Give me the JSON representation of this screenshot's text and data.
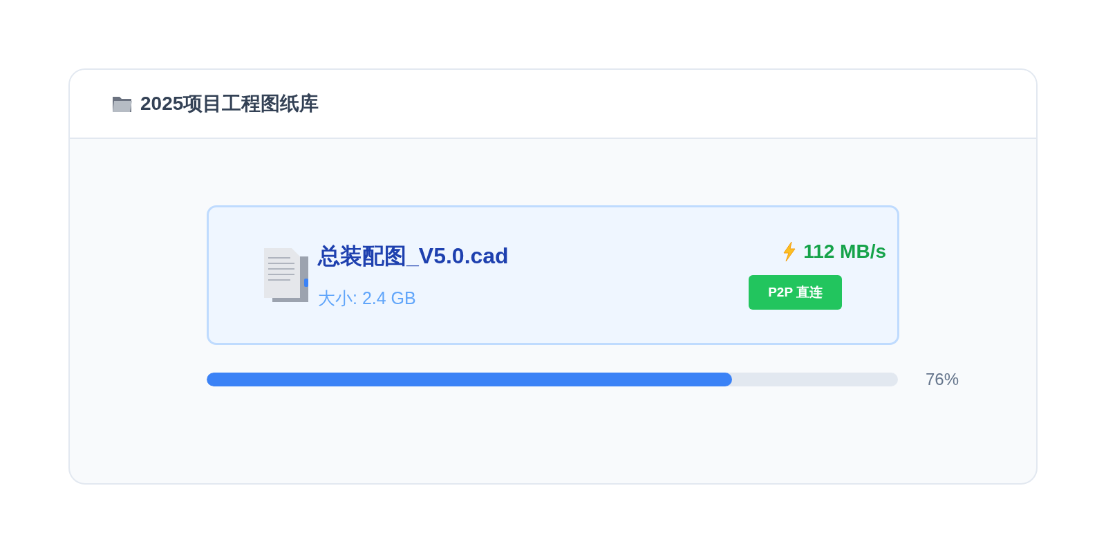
{
  "header": {
    "title": "2025项目工程图纸库"
  },
  "file": {
    "name": "总装配图_V5.0.cad",
    "size": "大小: 2.4 GB",
    "speed": "112 MB/s",
    "badge": "P2P 直连"
  },
  "progress": {
    "level": 0.76,
    "reading": "76%"
  }
}
